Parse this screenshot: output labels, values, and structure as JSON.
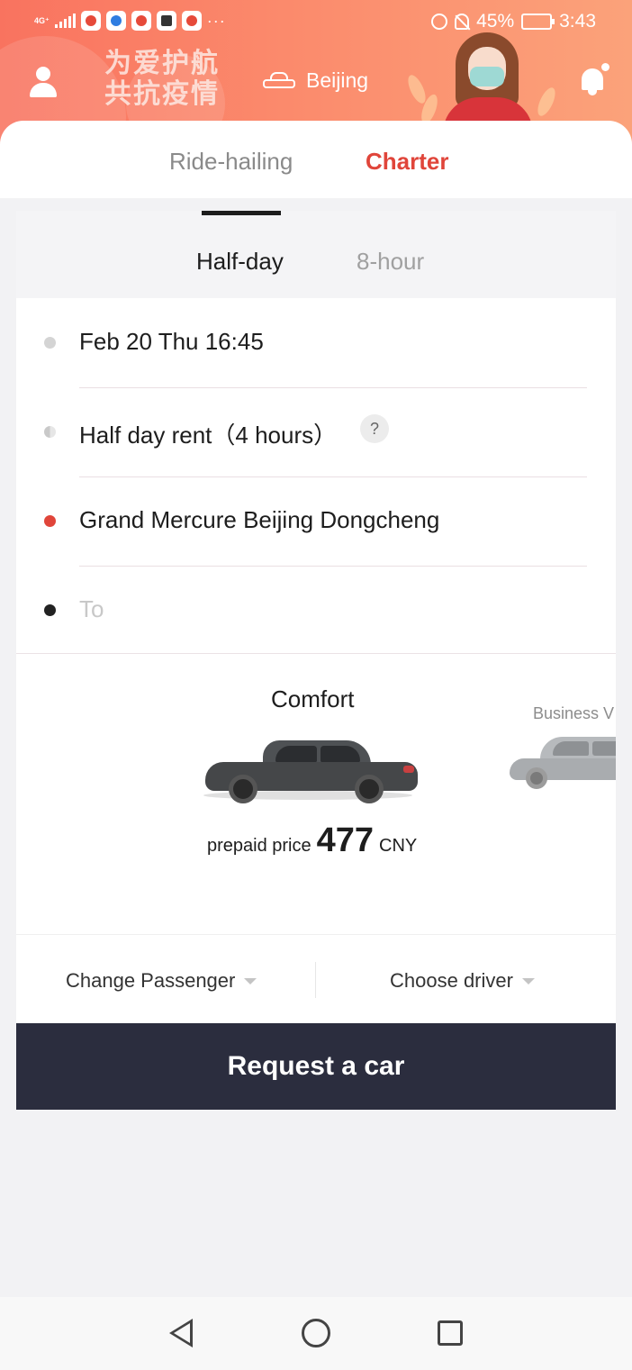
{
  "status_bar": {
    "network": "4G⁺",
    "more_indicator": "···",
    "battery_percent": "45%",
    "time": "3:43",
    "battery_level": 0.45,
    "icons": [
      "signal-icon",
      "app-notification-icon",
      "alarm-icon",
      "mute-icon",
      "battery-icon"
    ]
  },
  "header": {
    "slogan": "为爱护航\n共抗疫情",
    "city": "Beijing",
    "icons": [
      "user-icon",
      "car-icon",
      "bell-icon"
    ],
    "colors": {
      "banner_start": "#f9735f",
      "banner_end": "#fba27a"
    }
  },
  "main_tabs": [
    {
      "label": "Ride-hailing",
      "active": false
    },
    {
      "label": "Charter",
      "active": true
    }
  ],
  "sub_tabs": [
    {
      "label": "Half-day",
      "active": true
    },
    {
      "label": "8-hour",
      "active": false
    }
  ],
  "trip": {
    "datetime": "Feb 20 Thu 16:45",
    "duration": "Half day rent（4 hours）",
    "help_symbol": "?",
    "pickup": "Grand Mercure Beijing Dongcheng",
    "destination_placeholder": "To"
  },
  "vehicles": {
    "selected_name": "Comfort",
    "next_name": "Business V",
    "price_label": "prepaid price",
    "price_value": "477",
    "currency": "CNY"
  },
  "options": {
    "passenger": "Change Passenger",
    "driver": "Choose driver"
  },
  "action": {
    "request_label": "Request a car",
    "color": "#2b2d3e"
  },
  "accent_color": "#e0453a",
  "nav_bar": {
    "icons": [
      "back-icon",
      "home-icon",
      "recents-icon"
    ]
  }
}
